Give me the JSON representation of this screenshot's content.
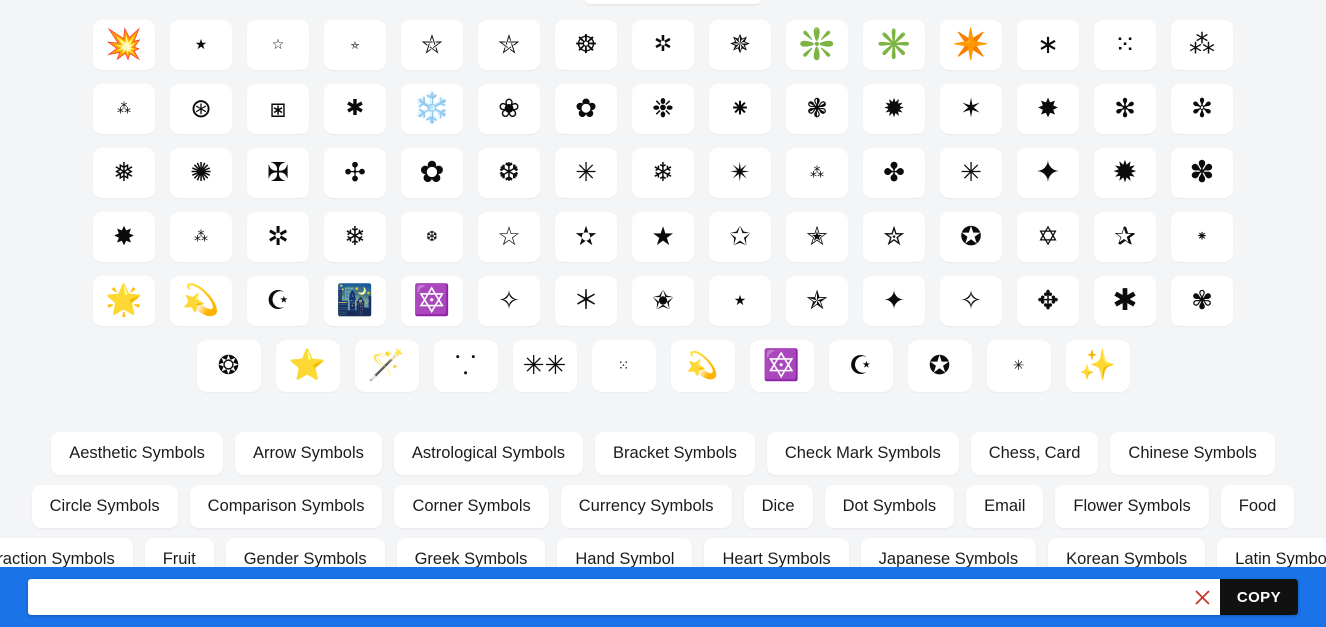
{
  "symbol_grid": {
    "rows": [
      {
        "cells": [
          {
            "glyph": "💥",
            "size": "big",
            "name": "symbol-collision"
          },
          {
            "glyph": "★",
            "size": "small",
            "name": "symbol-black-star"
          },
          {
            "glyph": "☆",
            "size": "small",
            "name": "symbol-white-star"
          },
          {
            "glyph": "⛤",
            "size": "xsmall",
            "name": "symbol-pentagram"
          },
          {
            "glyph": "⛥",
            "size": "med",
            "name": "symbol-right-handed-interlaced-pentagram"
          },
          {
            "glyph": "⛦",
            "size": "med",
            "name": "symbol-left-handed-interlaced-pentagram"
          },
          {
            "glyph": "☸",
            "size": "med",
            "name": "symbol-wheel-of-dharma"
          },
          {
            "glyph": "✲",
            "size": "",
            "name": "symbol-open-centre-asterisk"
          },
          {
            "glyph": "✵",
            "size": "med",
            "name": "symbol-eight-pointed-pinwheel-star"
          },
          {
            "glyph": "❇️",
            "size": "big",
            "name": "symbol-sparkle-orange"
          },
          {
            "glyph": "✳️",
            "size": "big",
            "name": "symbol-eight-spoked-asterisk"
          },
          {
            "glyph": "✴️",
            "size": "big",
            "name": "symbol-eight-pointed-star-green"
          },
          {
            "glyph": "∗",
            "size": "med",
            "name": "symbol-asterisk-operator"
          },
          {
            "glyph": "⁙",
            "size": "med",
            "name": "symbol-five-dot-punctuation"
          },
          {
            "glyph": "⁂",
            "size": "med",
            "name": "symbol-asterism"
          }
        ]
      },
      {
        "cells": [
          {
            "glyph": "⁂",
            "size": "small",
            "name": "symbol-asterism-small"
          },
          {
            "glyph": "⊛",
            "size": "med",
            "name": "symbol-circled-asterisk-operator"
          },
          {
            "glyph": "⧆",
            "size": "med",
            "name": "symbol-squared-asterisk"
          },
          {
            "glyph": "✱",
            "size": "",
            "name": "symbol-heavy-asterisk"
          },
          {
            "glyph": "❄️",
            "size": "big",
            "name": "symbol-snowflake-blue"
          },
          {
            "glyph": "❀",
            "size": "med",
            "name": "symbol-white-florette"
          },
          {
            "glyph": "✿",
            "size": "med",
            "name": "symbol-black-florette"
          },
          {
            "glyph": "❉",
            "size": "med",
            "name": "symbol-balloon-spoked-asterisk"
          },
          {
            "glyph": "⁕",
            "size": "med",
            "name": "symbol-flower-punctuation-mark"
          },
          {
            "glyph": "❃",
            "size": "med",
            "name": "symbol-heavy-teardrop-spoked-pinwheel-asterisk"
          },
          {
            "glyph": "✹",
            "size": "med",
            "name": "symbol-twelve-pointed-black-star"
          },
          {
            "glyph": "✶",
            "size": "med",
            "name": "symbol-six-pointed-black-star"
          },
          {
            "glyph": "✸",
            "size": "med",
            "name": "symbol-eight-pointed-rectilinear-black-star"
          },
          {
            "glyph": "✻",
            "size": "med",
            "name": "symbol-teardrop-spoked-asterisk"
          },
          {
            "glyph": "✼",
            "size": "med",
            "name": "symbol-open-centre-teardrop-spoked-asterisk"
          }
        ]
      },
      {
        "cells": [
          {
            "glyph": "❅",
            "size": "med",
            "name": "symbol-tight-trifoliate-snowflake"
          },
          {
            "glyph": "✺",
            "size": "med",
            "name": "symbol-sixteen-pointed-asterisk"
          },
          {
            "glyph": "✠",
            "size": "med",
            "name": "symbol-maltese-cross"
          },
          {
            "glyph": "✣",
            "size": "med",
            "name": "symbol-four-club-cross"
          },
          {
            "glyph": "✿",
            "size": "big",
            "name": "symbol-black-florette-large"
          },
          {
            "glyph": "❆",
            "size": "med",
            "name": "symbol-heavy-chevron-snowflake"
          },
          {
            "glyph": "✳",
            "size": "med",
            "name": "symbol-eight-spoked-asterisk-plain"
          },
          {
            "glyph": "❄",
            "size": "med",
            "name": "symbol-snowflake-mono"
          },
          {
            "glyph": "✴",
            "size": "med",
            "name": "symbol-eight-pointed-black-star"
          },
          {
            "glyph": "⁂",
            "size": "small",
            "name": "symbol-asterism-triple"
          },
          {
            "glyph": "✤",
            "size": "med",
            "name": "symbol-heavy-four-balloon-spoked-asterisk"
          },
          {
            "glyph": "✳",
            "size": "med",
            "name": "symbol-asterisk-spoked"
          },
          {
            "glyph": "✦",
            "size": "big",
            "name": "symbol-black-four-pointed-star-six"
          },
          {
            "glyph": "✹",
            "size": "big",
            "name": "symbol-twelve-pointed-star"
          },
          {
            "glyph": "✽",
            "size": "big",
            "name": "symbol-heavy-teardrop-spoked-asterisk"
          }
        ]
      },
      {
        "cells": [
          {
            "glyph": "✸",
            "size": "med",
            "name": "symbol-eight-pointed-rectilinear-star"
          },
          {
            "glyph": "⁂",
            "size": "small",
            "name": "symbol-asterism-stacked"
          },
          {
            "glyph": "✲",
            "size": "med",
            "name": "symbol-open-centre-asterisk-plain"
          },
          {
            "glyph": "❄",
            "size": "med",
            "name": "symbol-snowflake-plain"
          },
          {
            "glyph": "❆",
            "size": "small",
            "name": "symbol-heavy-chevron-snowflake-small"
          },
          {
            "glyph": "☆",
            "size": "med",
            "name": "symbol-white-star-outline"
          },
          {
            "glyph": "✫",
            "size": "med",
            "name": "symbol-open-centre-black-star"
          },
          {
            "glyph": "★",
            "size": "med",
            "name": "symbol-black-star-solid"
          },
          {
            "glyph": "✩",
            "size": "med",
            "name": "symbol-stress-outlined-white-star"
          },
          {
            "glyph": "✭",
            "size": "med",
            "name": "symbol-outlined-black-star"
          },
          {
            "glyph": "✮",
            "size": "med",
            "name": "symbol-heavy-outlined-black-star"
          },
          {
            "glyph": "✪",
            "size": "med",
            "name": "symbol-circled-white-star"
          },
          {
            "glyph": "✡",
            "size": "med",
            "name": "symbol-star-of-david"
          },
          {
            "glyph": "✰",
            "size": "med",
            "name": "symbol-shadowed-white-star"
          },
          {
            "glyph": "⁕",
            "size": "small",
            "name": "symbol-flower-punctuation-small"
          }
        ]
      },
      {
        "cells": [
          {
            "glyph": "🌟",
            "size": "big",
            "name": "symbol-glowing-star"
          },
          {
            "glyph": "💫",
            "size": "big",
            "name": "symbol-dizzy"
          },
          {
            "glyph": "☪",
            "size": "med",
            "name": "symbol-star-and-crescent-outline"
          },
          {
            "glyph": "🌃",
            "size": "big",
            "name": "symbol-night-with-stars"
          },
          {
            "glyph": "🔯",
            "size": "big",
            "name": "symbol-six-pointed-star-purple"
          },
          {
            "glyph": "✧",
            "size": "med",
            "name": "symbol-white-four-pointed-star-outline"
          },
          {
            "glyph": "＊",
            "size": "med",
            "name": "symbol-fullwidth-asterisk"
          },
          {
            "glyph": "✬",
            "size": "med",
            "name": "symbol-black-centre-white-star"
          },
          {
            "glyph": "★",
            "size": "small",
            "name": "symbol-black-star-tiny"
          },
          {
            "glyph": "✯",
            "size": "med",
            "name": "symbol-pinwheel-star"
          },
          {
            "glyph": "✦",
            "size": "med",
            "name": "symbol-black-four-pointed-star"
          },
          {
            "glyph": "✧",
            "size": "med",
            "name": "symbol-white-four-pointed-star"
          },
          {
            "glyph": "✥",
            "size": "med",
            "name": "symbol-four-club-spoked-asterisk"
          },
          {
            "glyph": "✱",
            "size": "big",
            "name": "symbol-heavy-asterisk-large"
          },
          {
            "glyph": "✾",
            "size": "med",
            "name": "symbol-six-petalled-outlined-florette"
          }
        ]
      },
      {
        "last": true,
        "cells": [
          {
            "glyph": "❂",
            "size": "med",
            "name": "symbol-circled-open-centre-eight-pointed-star"
          },
          {
            "glyph": "⭐",
            "size": "big",
            "name": "symbol-star-yellow"
          },
          {
            "glyph": "🪄",
            "size": "big",
            "name": "symbol-magic-wand"
          },
          {
            "glyph": "⸪",
            "size": "med",
            "name": "symbol-two-dots-over-one-dot"
          },
          {
            "glyph": "✳✳",
            "size": "med",
            "name": "symbol-double-eight-spoked-asterisk"
          },
          {
            "glyph": "⁙",
            "size": "small",
            "name": "symbol-five-dot-punctuation-small"
          },
          {
            "glyph": "💫",
            "size": "med",
            "name": "symbol-comet-outline"
          },
          {
            "glyph": "🔯",
            "size": "big",
            "name": "symbol-six-pointed-star-dot"
          },
          {
            "glyph": "☪",
            "size": "med",
            "name": "symbol-star-and-crescent"
          },
          {
            "glyph": "✪",
            "size": "med",
            "name": "symbol-circled-white-star-large"
          },
          {
            "glyph": "✳",
            "size": "small",
            "name": "symbol-small-asterisk"
          },
          {
            "glyph": "✨",
            "size": "big",
            "name": "symbol-sparkles"
          }
        ]
      }
    ]
  },
  "categories": {
    "rows": [
      [
        "Aesthetic Symbols",
        "Arrow Symbols",
        "Astrological Symbols",
        "Bracket Symbols",
        "Check Mark Symbols",
        "Chess, Card",
        "Chinese Symbols"
      ],
      [
        "Circle Symbols",
        "Comparison Symbols",
        "Corner Symbols",
        "Currency Symbols",
        "Dice",
        "Dot Symbols",
        "Email",
        "Flower Symbols",
        "Food"
      ],
      [
        "Fraction Symbols",
        "Fruit",
        "Gender Symbols",
        "Greek Symbols",
        "Hand Symbol",
        "Heart Symbols",
        "Japanese Symbols",
        "Korean Symbols",
        "Latin Symbols"
      ]
    ]
  },
  "bottom_bar": {
    "input_value": "",
    "input_placeholder": "",
    "clear_icon": "close-x-icon",
    "copy_label": "COPY",
    "bar_color": "#1a73e8",
    "copy_button_color": "#111111",
    "clear_icon_color": "#c0392b"
  }
}
